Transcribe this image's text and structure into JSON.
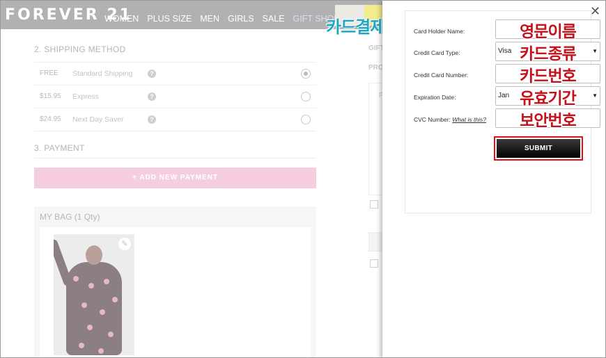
{
  "header": {
    "logo": "FOREVER 21",
    "nav": [
      "WOMEN",
      "PLUS SIZE",
      "MEN",
      "GIRLS",
      "SALE",
      "GIFT SHOP"
    ],
    "annotation": "카드결제"
  },
  "shipping": {
    "title": "2. SHIPPING METHOD",
    "options": [
      {
        "price": "FREE",
        "name": "Standard Shipping",
        "selected": true
      },
      {
        "price": "$15.95",
        "name": "Express",
        "selected": false
      },
      {
        "price": "$24.95",
        "name": "Next Day Saver",
        "selected": false
      }
    ]
  },
  "payment": {
    "title": "3. PAYMENT",
    "add_button": "+ ADD NEW PAYMENT"
  },
  "bag": {
    "title": "MY BAG (1 Qty)"
  },
  "side": {
    "gift": "GIFT",
    "pro": "PRO",
    "f": "F"
  },
  "modal": {
    "fields": [
      {
        "label": "Card Holder Name:",
        "value": "",
        "annotation": "영문이름"
      },
      {
        "label": "Credit Card Type:",
        "value": "Visa",
        "annotation": "카드종류"
      },
      {
        "label": "Credit Card Number:",
        "value": "",
        "annotation": "카드번호"
      },
      {
        "label": "Expiration Date:",
        "value": "Jan",
        "annotation": "유효기간"
      },
      {
        "label": "CVC Number:",
        "link": "What is this?",
        "value": "",
        "annotation": "보안번호"
      }
    ],
    "submit": "SUBMIT"
  }
}
